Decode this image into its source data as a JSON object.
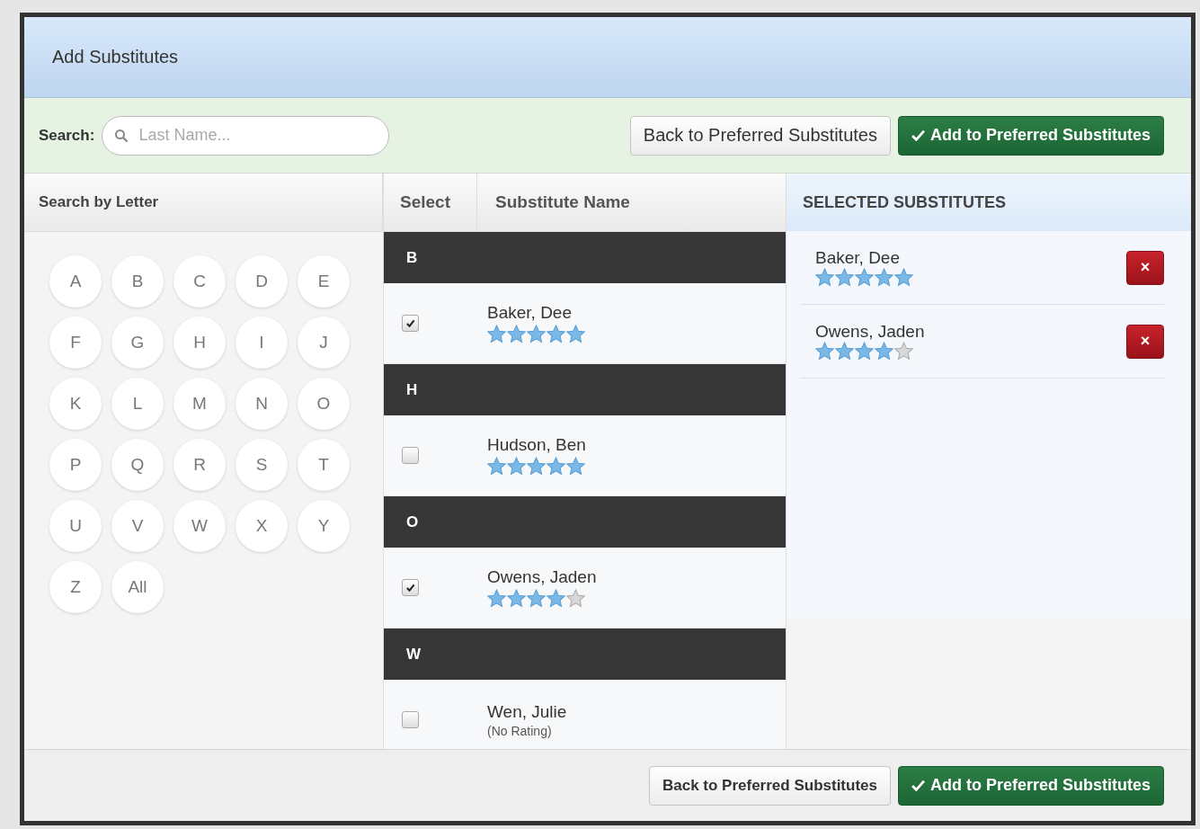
{
  "dialog": {
    "title": "Add Substitutes"
  },
  "toolbar": {
    "search_label": "Search:",
    "search": {
      "placeholder": "Last Name..."
    },
    "back_button": "Back to Preferred Substitutes",
    "add_button": "Add to Preferred Substitutes"
  },
  "letter_panel": {
    "title": "Search by Letter",
    "letters": [
      "A",
      "B",
      "C",
      "D",
      "E",
      "F",
      "G",
      "H",
      "I",
      "J",
      "K",
      "L",
      "M",
      "N",
      "O",
      "P",
      "Q",
      "R",
      "S",
      "T",
      "U",
      "V",
      "W",
      "X",
      "Y",
      "Z",
      "All"
    ]
  },
  "table": {
    "columns": [
      "Select",
      "Substitute Name"
    ],
    "groups": [
      {
        "letter": "B",
        "rows": [
          {
            "name": "Baker, Dee",
            "checked": true,
            "stars": 5
          }
        ]
      },
      {
        "letter": "H",
        "rows": [
          {
            "name": "Hudson, Ben",
            "checked": false,
            "stars": 5
          }
        ]
      },
      {
        "letter": "O",
        "rows": [
          {
            "name": "Owens, Jaden",
            "checked": true,
            "stars": 4
          }
        ]
      },
      {
        "letter": "W",
        "rows": [
          {
            "name": "Wen, Julie",
            "checked": false,
            "note": "(No Rating)"
          }
        ]
      }
    ]
  },
  "selected_panel": {
    "title": "SELECTED SUBSTITUTES",
    "items": [
      {
        "name": "Baker, Dee",
        "stars": 5,
        "remove": "×"
      },
      {
        "name": "Owens, Jaden",
        "stars": 4,
        "remove": "×"
      }
    ]
  },
  "footer": {
    "back_button": "Back to Preferred Substitutes",
    "add_button": "Add to Preferred Substitutes"
  }
}
